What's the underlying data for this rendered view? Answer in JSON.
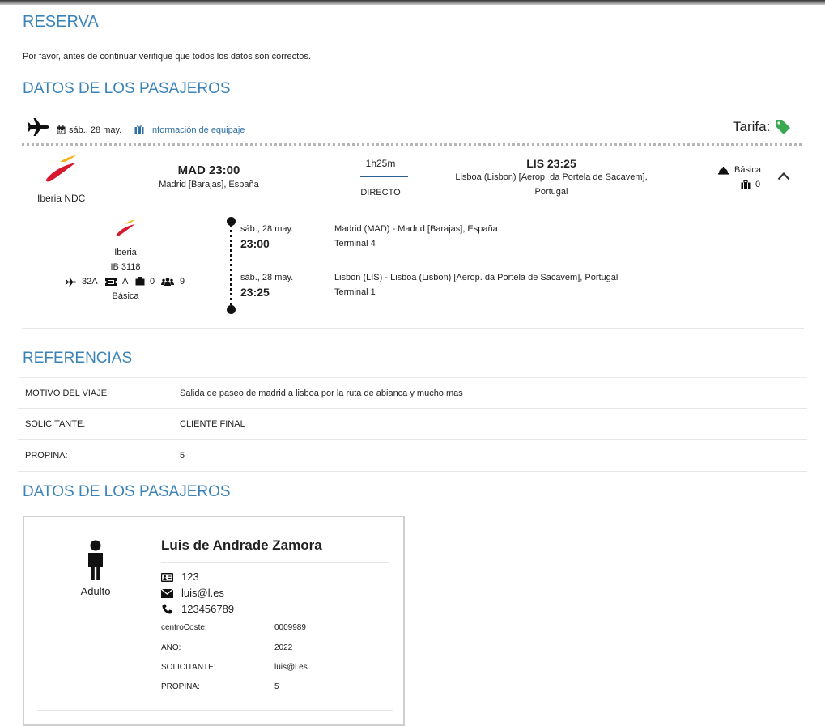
{
  "page": {
    "title": "RESERVA",
    "intro": "Por favor, antes de continuar verifique que todos los datos son correctos.",
    "passengers_heading": "DATOS DE LOS PASAJEROS",
    "references_heading": "REFERENCIAS",
    "passengers_heading_2": "DATOS DE LOS PASAJEROS"
  },
  "flight_bar": {
    "date": "sáb., 28 may.",
    "baggage_link": "Información de equipaje",
    "tarifa_label": "Tarifa:"
  },
  "summary": {
    "airline": "Iberia NDC",
    "origin_code_time": "MAD  23:00",
    "origin_place": "Madrid [Barajas], España",
    "duration": "1h25m",
    "stops": "DIRECTO",
    "dest_code_time": "LIS  23:25",
    "dest_place_line1": "Lisboa (Lisbon) [Aerop. da Portela de Sacavem],",
    "dest_place_line2": "Portugal",
    "fare": "Básica",
    "bags": "0"
  },
  "segment": {
    "airline": "Iberia",
    "flight_no": "IB 3118",
    "seat": "32A",
    "seat_class": "A",
    "bags": "0",
    "pax": "9",
    "fare": "Básica",
    "dep_date": "sáb., 28 may.",
    "dep_time": "23:00",
    "dep_place": "Madrid (MAD) - Madrid [Barajas], España",
    "dep_terminal": "Terminal 4",
    "arr_date": "sáb., 28 may.",
    "arr_time": "23:25",
    "arr_place": "Lisbon (LIS) - Lisboa (Lisbon) [Aerop. da Portela de Sacavem], Portugal",
    "arr_terminal": "Terminal 1"
  },
  "references": [
    {
      "label": "MOTIVO DEL VIAJE:",
      "value": "Salida de paseo de madrid a lisboa por la ruta de abianca y mucho mas"
    },
    {
      "label": "SOLICITANTE:",
      "value": "CLIENTE FINAL"
    },
    {
      "label": "PROPINA:",
      "value": "5"
    }
  ],
  "passenger": {
    "name": "Luis de Andrade Zamora",
    "type": "Adulto",
    "document": "123",
    "email": "luis@l.es",
    "phone": "123456789",
    "fields": [
      {
        "label": "centroCoste:",
        "value": "0009989"
      },
      {
        "label": "AÑO:",
        "value": "2022"
      },
      {
        "label": "SOLICITANTE:",
        "value": "luis@l.es"
      },
      {
        "label": "PROPINA:",
        "value": "5"
      }
    ]
  },
  "colors": {
    "heading_blue": "#3a83b8",
    "iberia_red": "#d7192d",
    "iberia_yellow": "#f5b21b",
    "tag_green": "#3aa851"
  }
}
